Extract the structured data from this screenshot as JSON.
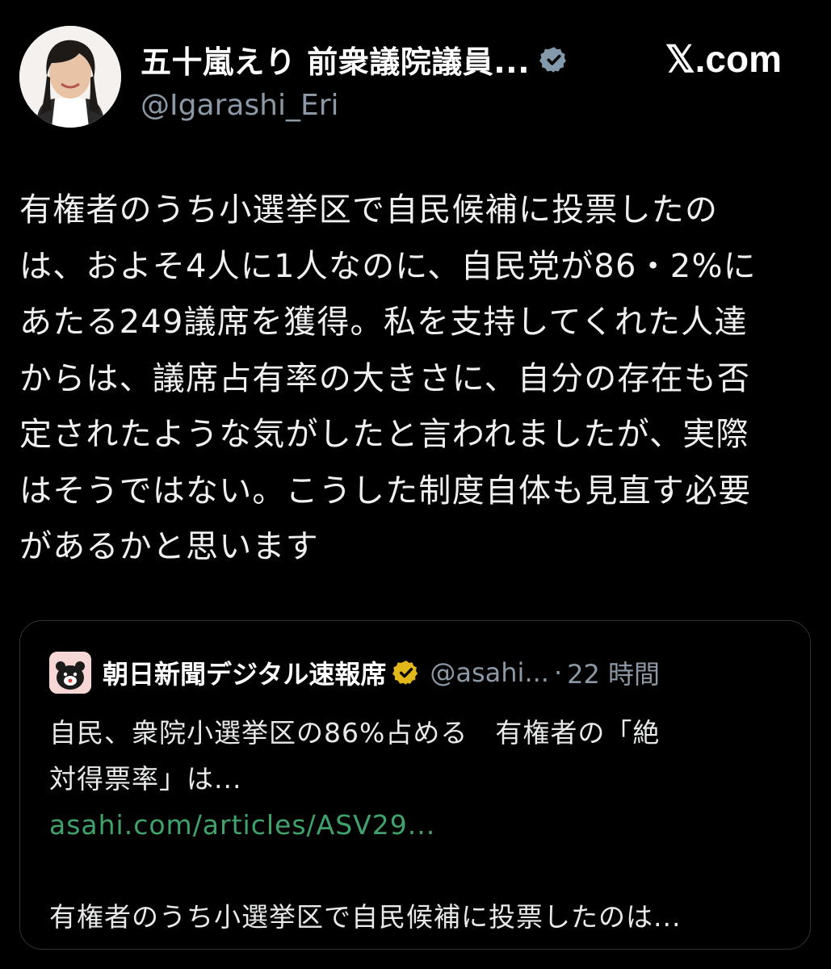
{
  "post": {
    "author": {
      "display_name": "五十嵐えり 前衆議院議員...",
      "handle": "@Igarashi_Eri",
      "verified_icon": "verified-badge-icon",
      "badge_color": "#829aab"
    },
    "source_label": "𝕏.com",
    "text_lines": [
      "有権者のうち小選挙区で自民候補に投票したの",
      "は、およそ4人に1人なのに、自民党が86・2%に",
      "あたる249議席を獲得。私を支持してくれた人達",
      "からは、議席占有率の大きさに、自分の存在も否",
      "定されたような気がしたと言われましたが、実際",
      "はそうではない。こうした制度自体も見直す必要",
      "があるかと思います"
    ]
  },
  "quote": {
    "author": {
      "display_name": "朝日新聞デジタル速報席",
      "handle": "@asahi...",
      "separator": "·",
      "time": "22 時間",
      "badge_color": "#e2b719",
      "verified_icon": "gold-verified-badge-icon"
    },
    "body_lines": [
      "自民、衆院小選挙区の86%占める　有権者の「絶",
      "対得票率」は..."
    ],
    "link": "asahi.com/articles/ASV29...",
    "excerpt": "有権者のうち小選挙区で自民候補に投票したのは..."
  },
  "colors": {
    "background": "#000000",
    "text": "#e7e9ea",
    "secondary": "#8b98a5",
    "link": "#3fa36b",
    "border": "#2f3336"
  }
}
